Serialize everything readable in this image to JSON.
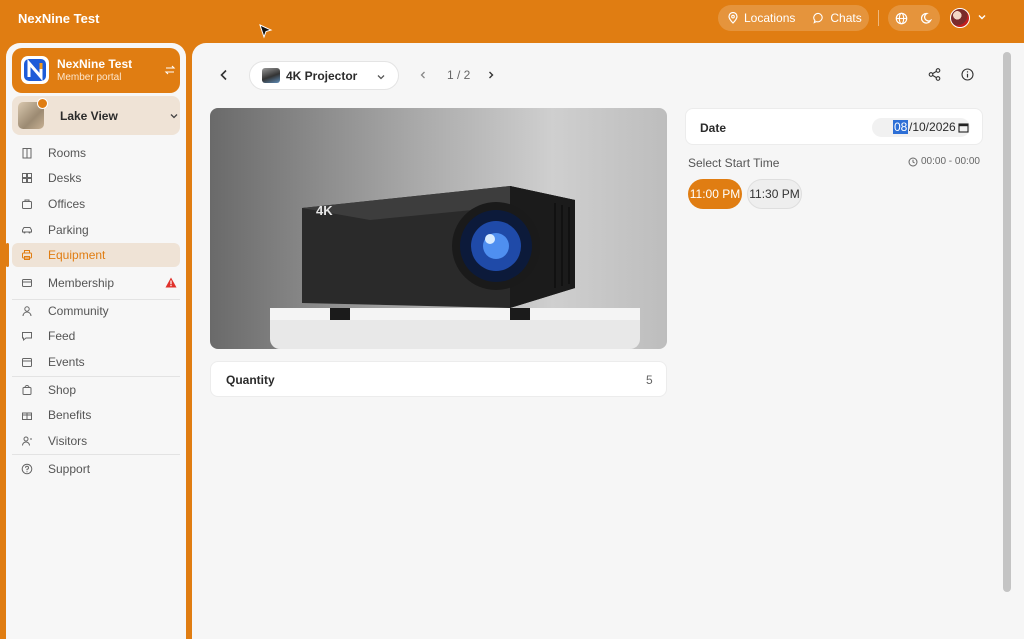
{
  "topbar": {
    "brand": "NexNine Test",
    "locations_label": "Locations",
    "chats_label": "Chats"
  },
  "sidebar": {
    "org": {
      "name": "NexNine Test",
      "subtitle": "Member portal"
    },
    "location": {
      "name": "Lake View"
    },
    "items": [
      {
        "label": "Rooms",
        "icon": "building-icon"
      },
      {
        "label": "Desks",
        "icon": "grid-icon"
      },
      {
        "label": "Offices",
        "icon": "office-icon"
      },
      {
        "label": "Parking",
        "icon": "car-icon"
      },
      {
        "label": "Equipment",
        "icon": "printer-icon",
        "active": true
      },
      {
        "label": "Membership",
        "icon": "card-icon",
        "warning": true
      },
      {
        "label": "Community",
        "icon": "people-icon"
      },
      {
        "label": "Feed",
        "icon": "chat-icon"
      },
      {
        "label": "Events",
        "icon": "calendar-icon"
      },
      {
        "label": "Shop",
        "icon": "bag-icon"
      },
      {
        "label": "Benefits",
        "icon": "gift-icon"
      },
      {
        "label": "Visitors",
        "icon": "visitor-icon"
      },
      {
        "label": "Support",
        "icon": "help-icon"
      }
    ]
  },
  "main": {
    "product_name": "4K Projector",
    "pagination": "1 / 2",
    "hero_badge": "4K",
    "quantity": {
      "label": "Quantity",
      "value": "5"
    },
    "date": {
      "label": "Date",
      "month": "08",
      "rest": "/10/2026"
    },
    "start_time": {
      "label": "Select Start Time",
      "hours": "00:00 - 00:00",
      "slots": [
        "11:00 PM",
        "11:30 PM"
      ]
    }
  },
  "colors": {
    "accent": "#e07d12",
    "background": "#f6f6f6",
    "selection": "#2d6fd6",
    "warning": "#e0312b"
  }
}
